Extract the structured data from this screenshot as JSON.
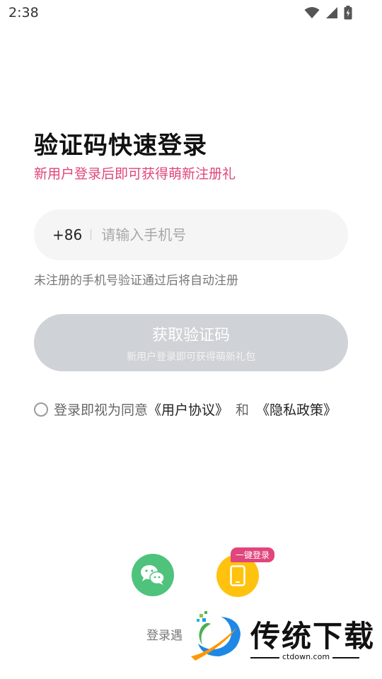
{
  "status_bar": {
    "time": "2:38",
    "icons": [
      "wifi-icon",
      "signal-icon",
      "battery-charging-icon"
    ]
  },
  "header": {
    "title": "验证码快速登录",
    "subtitle": "新用户登录后即可获得萌新注册礼"
  },
  "phone": {
    "country_code": "+86",
    "placeholder": "请输入手机号",
    "value": ""
  },
  "hint": "未注册的手机号验证通过后将自动注册",
  "code_button": {
    "label": "获取验证码",
    "sub_label": "新用户登录即可获得萌新礼包"
  },
  "agreement": {
    "prefix": "登录即视为同意",
    "user_agreement": "《用户协议》",
    "and": "和",
    "privacy_policy": "《隐私政策》",
    "checked": false
  },
  "bottom": {
    "wechat_icon": "wechat-icon",
    "onekey_icon": "phone-icon",
    "onekey_badge": "一键登录",
    "text": "登录遇"
  },
  "watermark": {
    "text": "传统下载",
    "domain": "ctdown.com"
  },
  "colors": {
    "accent": "#e0457b",
    "button_disabled": "#cfd2d6",
    "wechat_green": "#4fc27c",
    "onekey_yellow": "#ffc20e",
    "input_bg": "#f5f5f5"
  }
}
